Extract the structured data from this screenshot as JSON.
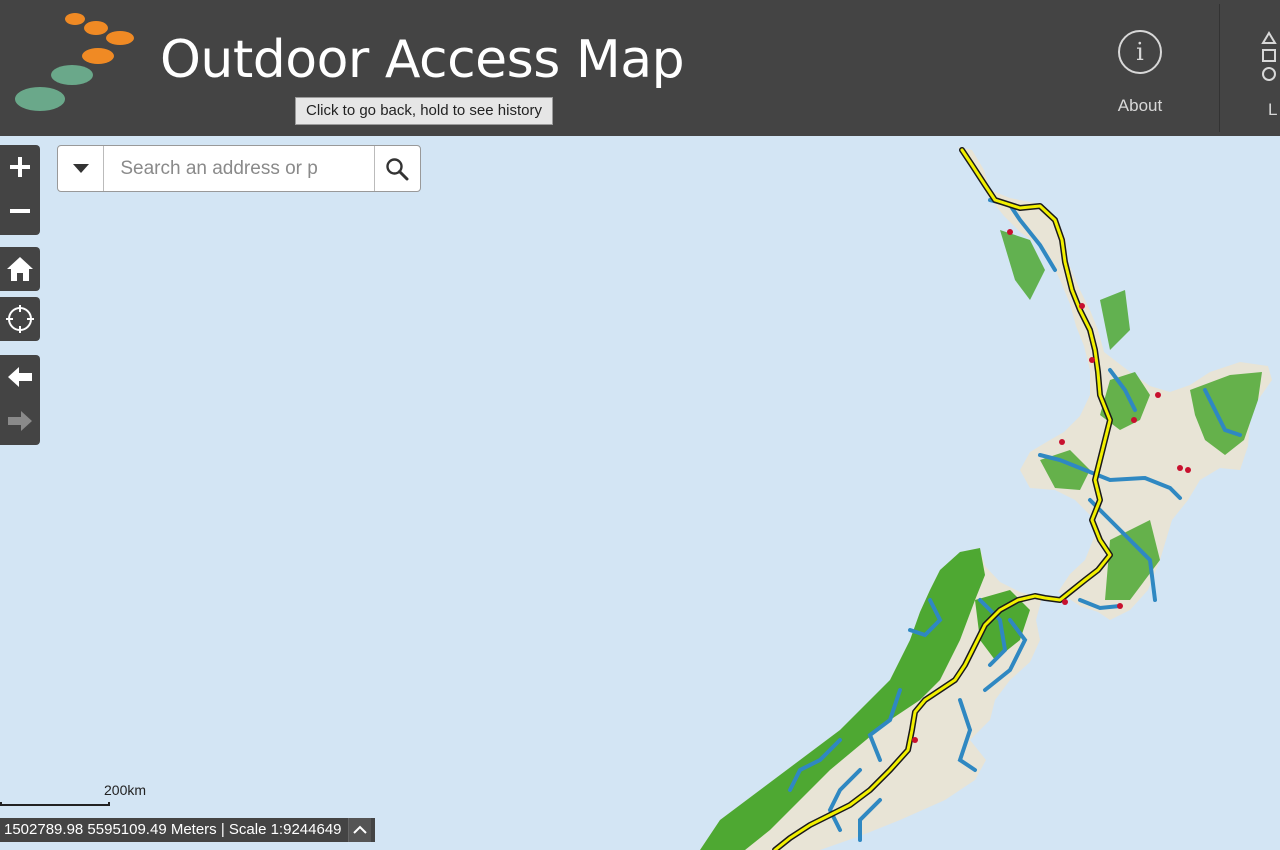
{
  "header": {
    "title": "Outdoor Access Map",
    "about_label": "About",
    "legend_label_partial": "L",
    "background": "#444444"
  },
  "tooltip": {
    "text": "Click to go back, hold to see history"
  },
  "search": {
    "placeholder": "Search an address or p"
  },
  "map_controls": [
    {
      "name": "zoom-in",
      "glyph": "+"
    },
    {
      "name": "zoom-out",
      "glyph": "−"
    },
    {
      "name": "home",
      "icon": "home-icon"
    },
    {
      "name": "locate",
      "icon": "locate-icon"
    },
    {
      "name": "back",
      "icon": "arrow-left-icon"
    },
    {
      "name": "forward",
      "icon": "arrow-right-icon",
      "disabled": true
    }
  ],
  "scalebar": {
    "label": "200km"
  },
  "coordinates": {
    "text": "1502789.98 5595109.49 Meters | Scale 1:9244649"
  },
  "colors": {
    "water": "#d3e5f4",
    "land": "#e8e4d6",
    "forest": "#4ea832",
    "walkway_yellow": "#f2f000",
    "river_blue": "#2f88c2",
    "logo_orange": "#f08a24",
    "logo_green": "#6aa88a"
  }
}
